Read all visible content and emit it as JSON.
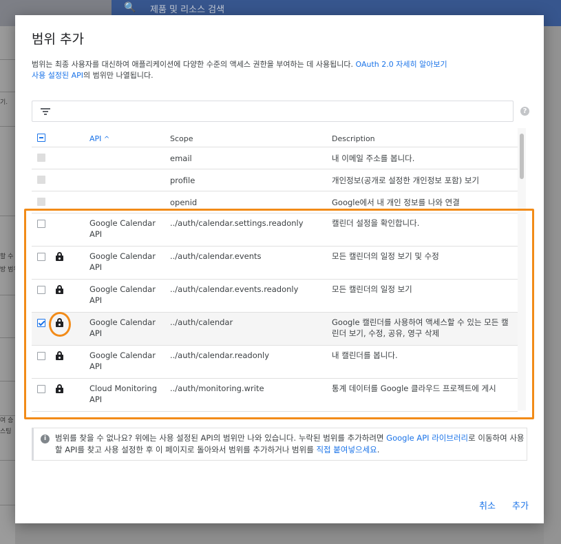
{
  "background": {
    "search_placeholder": "제품 및 리소스 검색",
    "left_texts": [
      "기.",
      "할 수",
      "방 범위",
      "여 승",
      "스팅"
    ]
  },
  "dialog": {
    "title": "범위 추가",
    "description_line1": "범위는 최종 사용자를 대신하여 애플리케이션에 다양한 수준의 액세스 권한을 부여하는 데 사용됩니다.",
    "description_link": "OAuth 2.0 자세히 알아보기",
    "description_line2_link": "사용 설정된 API",
    "description_line2_rest": "의 범위만 나열됩니다.",
    "filter_placeholder": "",
    "help_icon_glyph": "?"
  },
  "table": {
    "columns": {
      "api": "API",
      "scope": "Scope",
      "description": "Description"
    },
    "sort_glyph": "^",
    "rows": [
      {
        "api": "",
        "scope": "email",
        "description": "내 이메일 주소를 봅니다.",
        "checkbox": "disabled",
        "locked": false
      },
      {
        "api": "",
        "scope": "profile",
        "description": "개인정보(공개로 설정한 개인정보 포함) 보기",
        "checkbox": "disabled",
        "locked": false
      },
      {
        "api": "",
        "scope": "openid",
        "description": "Google에서 내 개인 정보를 나와 연결",
        "checkbox": "disabled",
        "locked": false
      },
      {
        "api": "Google Calendar API",
        "scope": "../auth/calendar.settings.readonly",
        "description": "캘린더 설정을 확인합니다.",
        "checkbox": "unchecked",
        "locked": false
      },
      {
        "api": "Google Calendar API",
        "scope": "../auth/calendar.events",
        "description": "모든 캘린더의 일정 보기 및 수정",
        "checkbox": "unchecked",
        "locked": true
      },
      {
        "api": "Google Calendar API",
        "scope": "../auth/calendar.events.readonly",
        "description": "모든 캘린더의 일정 보기",
        "checkbox": "unchecked",
        "locked": true
      },
      {
        "api": "Google Calendar API",
        "scope": "../auth/calendar",
        "description": "Google 캘린더를 사용하여 액세스할 수 있는 모든 캘린더 보기, 수정, 공유, 영구 삭제",
        "checkbox": "checked",
        "locked": true
      },
      {
        "api": "Google Calendar API",
        "scope": "../auth/calendar.readonly",
        "description": "내 캘린더를 봅니다.",
        "checkbox": "unchecked",
        "locked": true
      },
      {
        "api": "Cloud Monitoring API",
        "scope": "../auth/monitoring.write",
        "description": "통계 데이터를 Google 클라우드 프로젝트에 게시",
        "checkbox": "unchecked",
        "locked": true
      }
    ]
  },
  "info": {
    "icon_glyph": "i",
    "text_part1": "범위를 찾을 수 없나요? 위에는 사용 설정된 API의 범위만 나와 있습니다. 누락된 범위를 추가하려면 ",
    "link1": "Google API 라이브러리",
    "text_part2": "로 이동하여 사용할 API를 찾고 사용 설정한 후 이 페이지로 돌아와서 범위를 추가하거나 범위를 ",
    "link2": "직접 붙여넣으세요",
    "text_part3": "."
  },
  "buttons": {
    "cancel": "취소",
    "add": "추가"
  },
  "colors": {
    "accent": "#1a73e8",
    "highlight": "#f28b18"
  }
}
